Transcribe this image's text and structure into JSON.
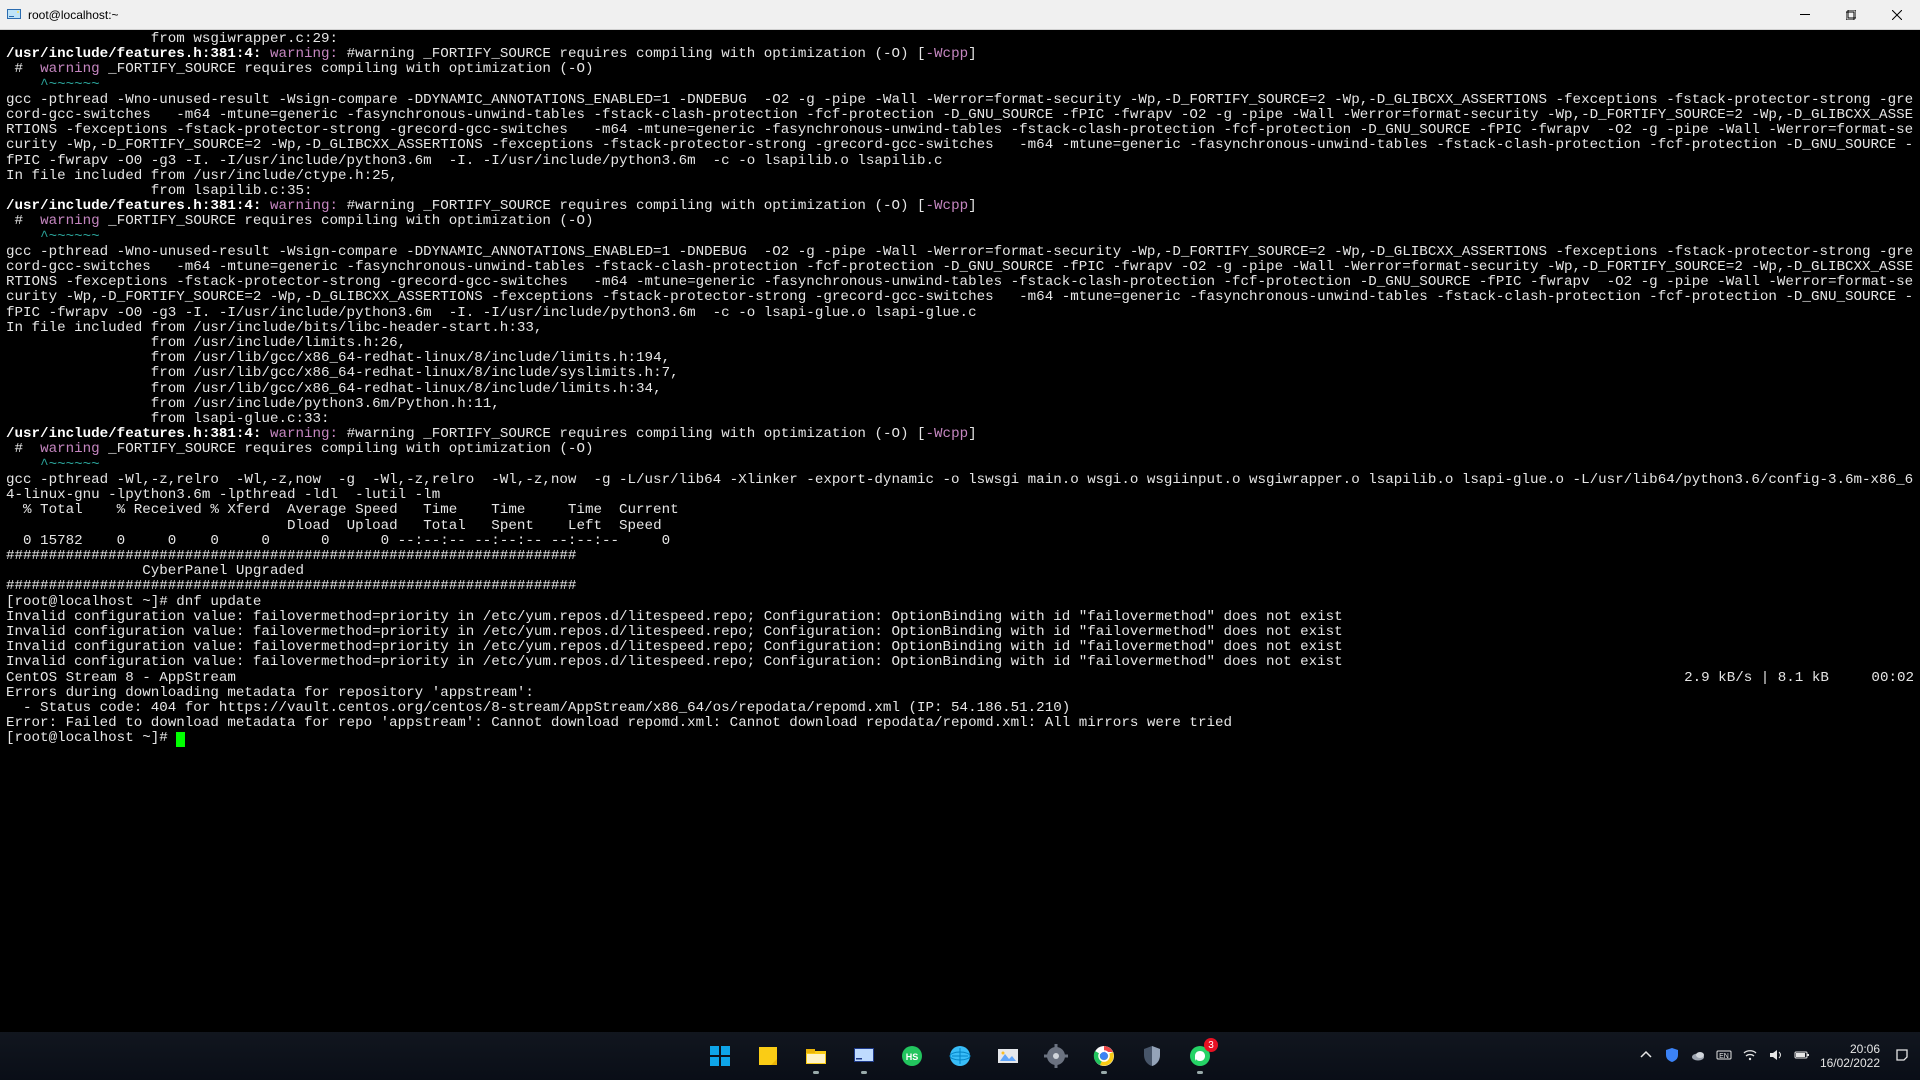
{
  "window": {
    "title": "root@localhost:~"
  },
  "terminal": {
    "from_wsgiwrapper": "                 from wsgiwrapper.c:29:",
    "features_path": "/usr/include/features.h:381:4:",
    "warning_word": "warning:",
    "wcpp_pre": "#warning _FORTIFY_SOURCE requires compiling with optimization (-O) [",
    "wcpp_flag": "-Wcpp",
    "wcpp_post": "]",
    "hash_pre": " #  ",
    "warning_only": "warning",
    "fortify_tail": " _FORTIFY_SOURCE requires compiling with optimization (-O)",
    "tilde": "    ^~~~~~~",
    "gcc_block1": "gcc -pthread -Wno-unused-result -Wsign-compare -DDYNAMIC_ANNOTATIONS_ENABLED=1 -DNDEBUG  -O2 -g -pipe -Wall -Werror=format-security -Wp,-D_FORTIFY_SOURCE=2 -Wp,-D_GLIBCXX_ASSERTIONS -fexceptions -fstack-protector-strong -grecord-gcc-switches   -m64 -mtune=generic -fasynchronous-unwind-tables -fstack-clash-protection -fcf-protection -D_GNU_SOURCE -fPIC -fwrapv -O2 -g -pipe -Wall -Werror=format-security -Wp,-D_FORTIFY_SOURCE=2 -Wp,-D_GLIBCXX_ASSERTIONS -fexceptions -fstack-protector-strong -grecord-gcc-switches   -m64 -mtune=generic -fasynchronous-unwind-tables -fstack-clash-protection -fcf-protection -D_GNU_SOURCE -fPIC -fwrapv  -O2 -g -pipe -Wall -Werror=format-security -Wp,-D_FORTIFY_SOURCE=2 -Wp,-D_GLIBCXX_ASSERTIONS -fexceptions -fstack-protector-strong -grecord-gcc-switches   -m64 -mtune=generic -fasynchronous-unwind-tables -fstack-clash-protection -fcf-protection -D_GNU_SOURCE -fPIC -fwrapv -O0 -g3 -I. -I/usr/include/python3.6m  -I. -I/usr/include/python3.6m  -c -o lsapilib.o lsapilib.c",
    "include_ctype": "In file included from /usr/include/ctype.h:25,",
    "from_lsapilib": "                 from lsapilib.c:35:",
    "gcc_block2": "gcc -pthread -Wno-unused-result -Wsign-compare -DDYNAMIC_ANNOTATIONS_ENABLED=1 -DNDEBUG  -O2 -g -pipe -Wall -Werror=format-security -Wp,-D_FORTIFY_SOURCE=2 -Wp,-D_GLIBCXX_ASSERTIONS -fexceptions -fstack-protector-strong -grecord-gcc-switches   -m64 -mtune=generic -fasynchronous-unwind-tables -fstack-clash-protection -fcf-protection -D_GNU_SOURCE -fPIC -fwrapv -O2 -g -pipe -Wall -Werror=format-security -Wp,-D_FORTIFY_SOURCE=2 -Wp,-D_GLIBCXX_ASSERTIONS -fexceptions -fstack-protector-strong -grecord-gcc-switches   -m64 -mtune=generic -fasynchronous-unwind-tables -fstack-clash-protection -fcf-protection -D_GNU_SOURCE -fPIC -fwrapv  -O2 -g -pipe -Wall -Werror=format-security -Wp,-D_FORTIFY_SOURCE=2 -Wp,-D_GLIBCXX_ASSERTIONS -fexceptions -fstack-protector-strong -grecord-gcc-switches   -m64 -mtune=generic -fasynchronous-unwind-tables -fstack-clash-protection -fcf-protection -D_GNU_SOURCE -fPIC -fwrapv -O0 -g3 -I. -I/usr/include/python3.6m  -I. -I/usr/include/python3.6m  -c -o lsapi-glue.o lsapi-glue.c",
    "include_bits": "In file included from /usr/include/bits/libc-header-start.h:33,",
    "from_limits26": "                 from /usr/include/limits.h:26,",
    "from_limits194": "                 from /usr/lib/gcc/x86_64-redhat-linux/8/include/limits.h:194,",
    "from_syslimits7": "                 from /usr/lib/gcc/x86_64-redhat-linux/8/include/syslimits.h:7,",
    "from_limits34": "                 from /usr/lib/gcc/x86_64-redhat-linux/8/include/limits.h:34,",
    "from_python11": "                 from /usr/include/python3.6m/Python.h:11,",
    "from_lsapi_glue33": "                 from lsapi-glue.c:33:",
    "gcc_link": "gcc -pthread -Wl,-z,relro  -Wl,-z,now  -g  -Wl,-z,relro  -Wl,-z,now  -g -L/usr/lib64 -Xlinker -export-dynamic -o lswsgi main.o wsgi.o wsgiinput.o wsgiwrapper.o lsapilib.o lsapi-glue.o -L/usr/lib64/python3.6/config-3.6m-x86_64-linux-gnu -lpython3.6m -lpthread -ldl  -lutil -lm",
    "curl_head": "  % Total    % Received % Xferd  Average Speed   Time    Time     Time  Current",
    "curl_head2": "                                 Dload  Upload   Total   Spent    Left  Speed",
    "curl_row": "  0 15782    0     0    0     0      0      0 --:--:-- --:--:-- --:--:--     0",
    "hashes": "###################################################################",
    "cyberpanel": "                CyberPanel Upgraded",
    "prompt1": "[root@localhost ~]# dnf update",
    "invalid_cfg": "Invalid configuration value: failovermethod=priority in /etc/yum.repos.d/litespeed.repo; Configuration: OptionBinding with id \"failovermethod\" does not exist",
    "centos_line_left": "CentOS Stream 8 - AppStream",
    "centos_line_right": "2.9 kB/s | 8.1 kB     00:02",
    "err_meta": "Errors during downloading metadata for repository 'appstream':",
    "status404": "  - Status code: 404 for https://vault.centos.org/centos/8-stream/AppStream/x86_64/os/repodata/repomd.xml (IP: 54.186.51.210)",
    "err_final": "Error: Failed to download metadata for repo 'appstream': Cannot download repomd.xml: Cannot download repodata/repomd.xml: All mirrors were tried",
    "prompt_empty": "[root@localhost ~]# "
  },
  "taskbar": {
    "badge_count": "3"
  },
  "clock": {
    "time": "20:06",
    "date": "16/02/2022"
  }
}
